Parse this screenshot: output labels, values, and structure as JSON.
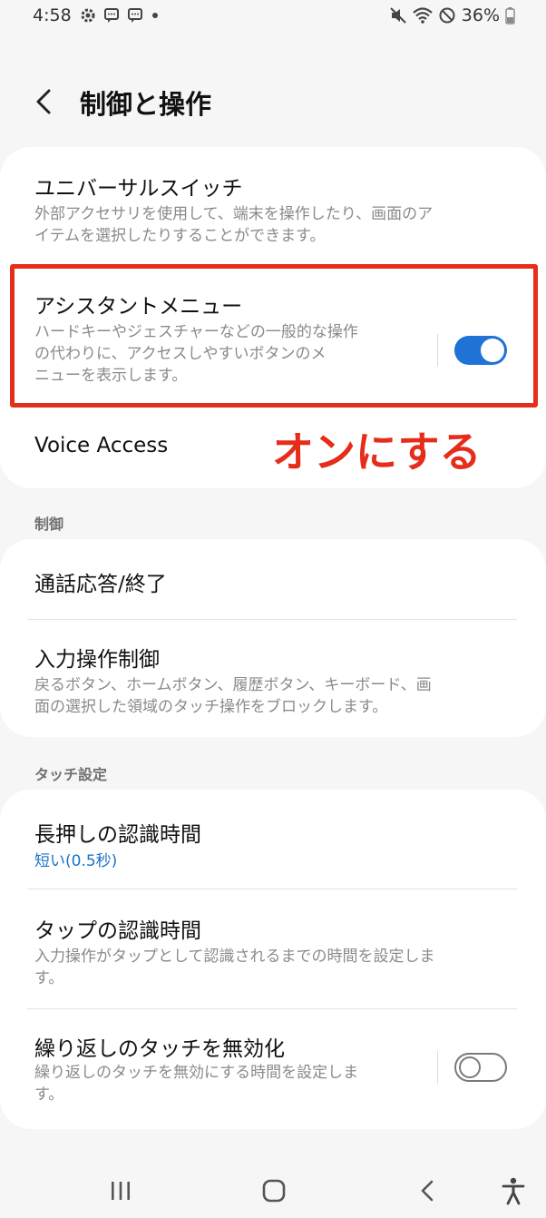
{
  "status": {
    "time": "4:58",
    "battery": "36%"
  },
  "header": {
    "title": "制御と操作"
  },
  "card1": {
    "items": [
      {
        "title": "ユニバーサルスイッチ",
        "desc_lines": [
          "外部アクセサリを使用して、端末を操作したり、画面のア",
          "イテムを選択したりすることができます。"
        ]
      },
      {
        "title": "アシスタントメニュー",
        "desc_lines": [
          "ハードキーやジェスチャーなどの一般的な操作",
          "の代わりに、アクセスしやすいボタンのメ",
          "ニューを表示します。"
        ],
        "toggle_on": true
      },
      {
        "title": "Voice Access"
      }
    ]
  },
  "annotation": {
    "text": "オンにする",
    "color": "#e62d1a"
  },
  "section_control": {
    "label": "制御",
    "items": [
      {
        "title": "通話応答/終了"
      },
      {
        "title": "入力操作制御",
        "desc_lines": [
          "戻るボタン、ホームボタン、履歴ボタン、キーボード、画",
          "面の選択した領域のタッチ操作をブロックします。"
        ]
      }
    ]
  },
  "section_touch": {
    "label": "タッチ設定",
    "items": [
      {
        "title": "長押しの認識時間",
        "value": "短い(0.5秒)"
      },
      {
        "title": "タップの認識時間",
        "desc_lines": [
          "入力操作がタップとして認識されるまでの時間を設定しま",
          "す。"
        ]
      },
      {
        "title": "繰り返しのタッチを無効化",
        "desc_lines": [
          "繰り返しのタッチを無効にする時間を設定しま",
          "す。"
        ],
        "toggle_on": false
      }
    ]
  },
  "nav": {
    "icons": [
      "recents-icon",
      "home-icon",
      "back-icon",
      "accessibility-icon"
    ]
  },
  "colors": {
    "accent": "#1f72d6",
    "value_blue": "#1a73c8",
    "annotation_red": "#e62d1a"
  }
}
